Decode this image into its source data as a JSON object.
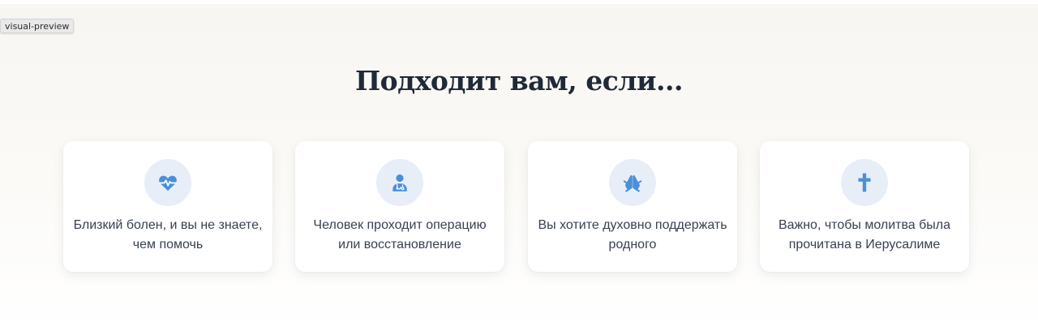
{
  "preview_tag": "visual-preview",
  "heading": "Подходит вам, если...",
  "colors": {
    "accent": "#4a90d9",
    "icon_bg": "#e7eef8",
    "heading": "#1f2937",
    "text": "#374151"
  },
  "cards": [
    {
      "icon": "heart-pulse-icon",
      "text": "Близкий болен, и вы не знаете, чем помочь"
    },
    {
      "icon": "doctor-icon",
      "text": "Человек проходит операцию или восстановление"
    },
    {
      "icon": "praying-hands-icon",
      "text": "Вы хотите духовно поддержать родного"
    },
    {
      "icon": "cross-icon",
      "text": "Важно, чтобы молитва была прочитана в Иерусалиме"
    }
  ]
}
